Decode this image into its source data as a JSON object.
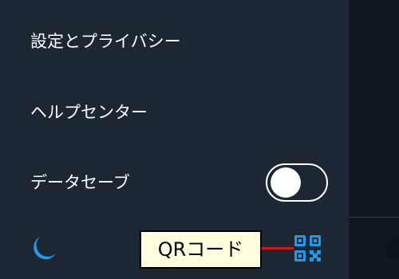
{
  "menu": {
    "items": [
      {
        "label": "設定とプライバシー"
      },
      {
        "label": "ヘルプセンター"
      },
      {
        "label": "データセーブ"
      }
    ]
  },
  "data_saver": {
    "enabled": false
  },
  "bottom_bar": {
    "night_mode_icon": "moon-icon",
    "qr_icon": "qr-code-icon",
    "qr_label": "QRコード"
  },
  "colors": {
    "accent": "#1d9bf0",
    "drawer_bg": "#1c2733",
    "label_bg": "#ffffe0",
    "connector": "#e0121b"
  }
}
